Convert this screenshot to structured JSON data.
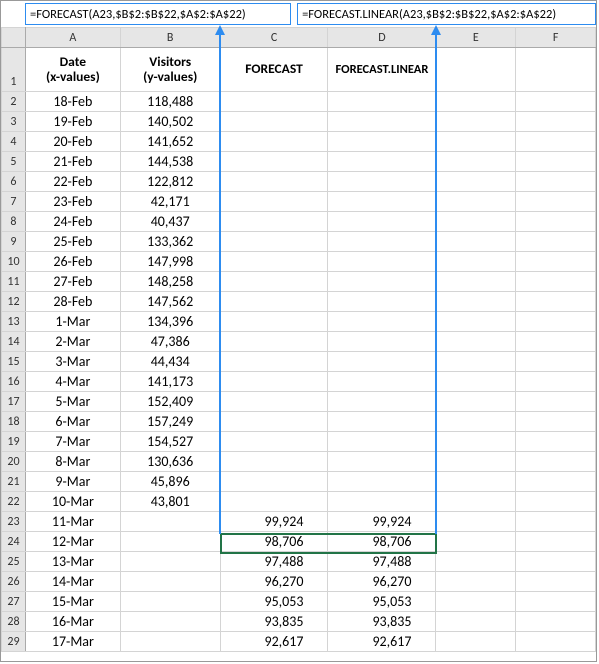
{
  "formulas": {
    "forecast": "=FORECAST(A23,$B$2:$B$22,$A$2:$A$22)",
    "forecast_linear": "=FORECAST.LINEAR(A23,$B$2:$B$22,$A$2:$A$22)"
  },
  "columns": [
    "A",
    "B",
    "C",
    "D",
    "E",
    "F"
  ],
  "headers": {
    "A_line1": "Date",
    "A_line2": "(x-values)",
    "B_line1": "Visitors",
    "B_line2": "(y-values)",
    "C": "FORECAST",
    "D": "FORECAST.LINEAR"
  },
  "rows": [
    {
      "n": 2,
      "date": "18-Feb",
      "vis": "118,488",
      "c": "",
      "d": ""
    },
    {
      "n": 3,
      "date": "19-Feb",
      "vis": "140,502",
      "c": "",
      "d": ""
    },
    {
      "n": 4,
      "date": "20-Feb",
      "vis": "141,652",
      "c": "",
      "d": ""
    },
    {
      "n": 5,
      "date": "21-Feb",
      "vis": "144,538",
      "c": "",
      "d": ""
    },
    {
      "n": 6,
      "date": "22-Feb",
      "vis": "122,812",
      "c": "",
      "d": ""
    },
    {
      "n": 7,
      "date": "23-Feb",
      "vis": "42,171",
      "c": "",
      "d": ""
    },
    {
      "n": 8,
      "date": "24-Feb",
      "vis": "40,437",
      "c": "",
      "d": ""
    },
    {
      "n": 9,
      "date": "25-Feb",
      "vis": "133,362",
      "c": "",
      "d": ""
    },
    {
      "n": 10,
      "date": "26-Feb",
      "vis": "147,998",
      "c": "",
      "d": ""
    },
    {
      "n": 11,
      "date": "27-Feb",
      "vis": "148,258",
      "c": "",
      "d": ""
    },
    {
      "n": 12,
      "date": "28-Feb",
      "vis": "147,562",
      "c": "",
      "d": ""
    },
    {
      "n": 13,
      "date": "1-Mar",
      "vis": "134,396",
      "c": "",
      "d": ""
    },
    {
      "n": 14,
      "date": "2-Mar",
      "vis": "47,386",
      "c": "",
      "d": ""
    },
    {
      "n": 15,
      "date": "3-Mar",
      "vis": "44,434",
      "c": "",
      "d": ""
    },
    {
      "n": 16,
      "date": "4-Mar",
      "vis": "141,173",
      "c": "",
      "d": ""
    },
    {
      "n": 17,
      "date": "5-Mar",
      "vis": "152,409",
      "c": "",
      "d": ""
    },
    {
      "n": 18,
      "date": "6-Mar",
      "vis": "157,249",
      "c": "",
      "d": ""
    },
    {
      "n": 19,
      "date": "7-Mar",
      "vis": "154,527",
      "c": "",
      "d": ""
    },
    {
      "n": 20,
      "date": "8-Mar",
      "vis": "130,636",
      "c": "",
      "d": ""
    },
    {
      "n": 21,
      "date": "9-Mar",
      "vis": "45,896",
      "c": "",
      "d": ""
    },
    {
      "n": 22,
      "date": "10-Mar",
      "vis": "43,801",
      "c": "",
      "d": ""
    },
    {
      "n": 23,
      "date": "11-Mar",
      "vis": "",
      "c": "99,924",
      "d": "99,924"
    },
    {
      "n": 24,
      "date": "12-Mar",
      "vis": "",
      "c": "98,706",
      "d": "98,706"
    },
    {
      "n": 25,
      "date": "13-Mar",
      "vis": "",
      "c": "97,488",
      "d": "97,488"
    },
    {
      "n": 26,
      "date": "14-Mar",
      "vis": "",
      "c": "96,270",
      "d": "96,270"
    },
    {
      "n": 27,
      "date": "15-Mar",
      "vis": "",
      "c": "95,053",
      "d": "95,053"
    },
    {
      "n": 28,
      "date": "16-Mar",
      "vis": "",
      "c": "93,835",
      "d": "93,835"
    },
    {
      "n": 29,
      "date": "17-Mar",
      "vis": "",
      "c": "92,617",
      "d": "92,617"
    }
  ],
  "chart_data": {
    "type": "table",
    "title": "FORECAST vs FORECAST.LINEAR example",
    "columns": [
      "Date (x-values)",
      "Visitors (y-values)",
      "FORECAST",
      "FORECAST.LINEAR"
    ],
    "known_x": [
      "18-Feb",
      "19-Feb",
      "20-Feb",
      "21-Feb",
      "22-Feb",
      "23-Feb",
      "24-Feb",
      "25-Feb",
      "26-Feb",
      "27-Feb",
      "28-Feb",
      "1-Mar",
      "2-Mar",
      "3-Mar",
      "4-Mar",
      "5-Mar",
      "6-Mar",
      "7-Mar",
      "8-Mar",
      "9-Mar",
      "10-Mar"
    ],
    "known_y": [
      118488,
      140502,
      141652,
      144538,
      122812,
      42171,
      40437,
      133362,
      147998,
      148258,
      147562,
      134396,
      47386,
      44434,
      141173,
      152409,
      157249,
      154527,
      130636,
      45896,
      43801
    ],
    "forecast_x": [
      "11-Mar",
      "12-Mar",
      "13-Mar",
      "14-Mar",
      "15-Mar",
      "16-Mar",
      "17-Mar"
    ],
    "forecast": [
      99924,
      98706,
      97488,
      96270,
      95053,
      93835,
      92617
    ],
    "forecast_linear": [
      99924,
      98706,
      97488,
      96270,
      95053,
      93835,
      92617
    ]
  }
}
